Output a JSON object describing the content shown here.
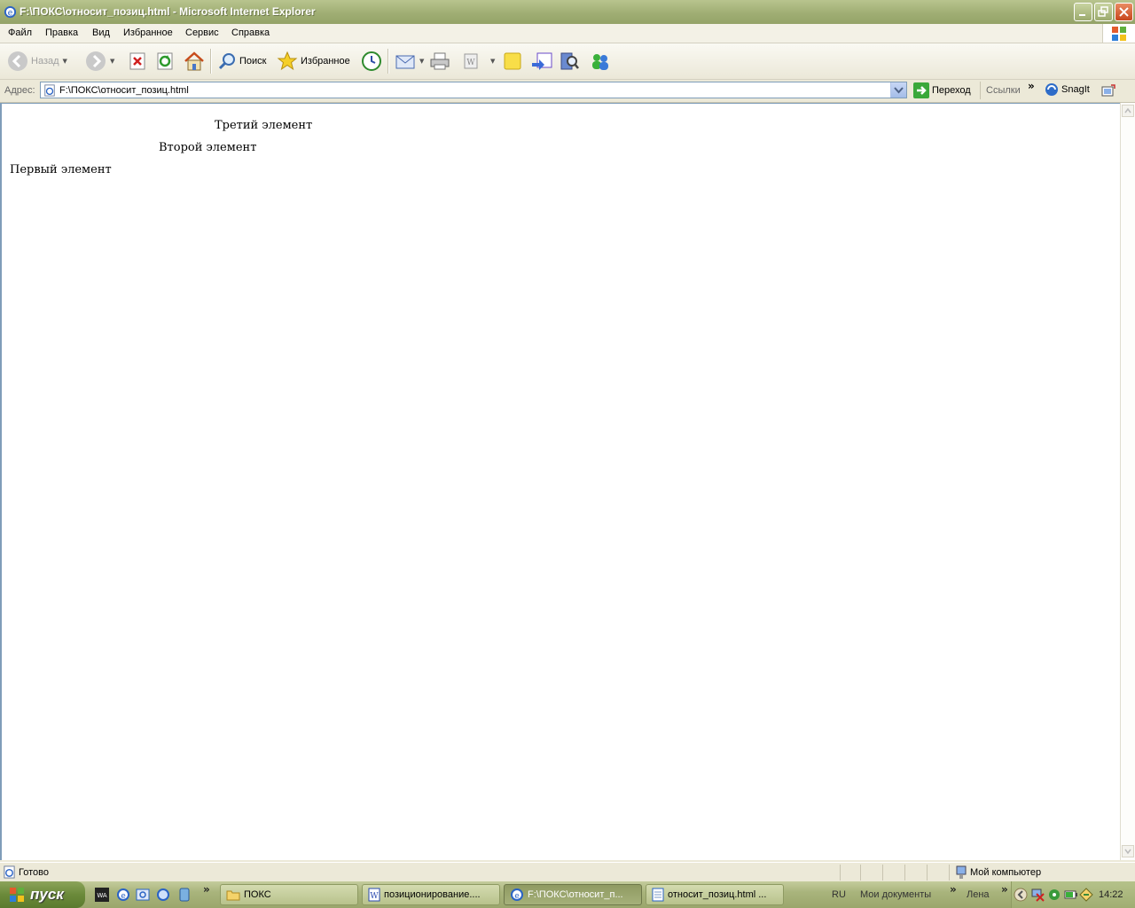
{
  "window": {
    "title": "F:\\ПОКС\\относит_позиц.html - Microsoft Internet Explorer"
  },
  "menu": [
    "Файл",
    "Правка",
    "Вид",
    "Избранное",
    "Сервис",
    "Справка"
  ],
  "toolbar": {
    "back_label": "Назад",
    "search_label": "Поиск",
    "favorites_label": "Избранное"
  },
  "address": {
    "label": "Адрес:",
    "url": "F:\\ПОКС\\относит_позиц.html",
    "go_label": "Переход",
    "links_label": "Ссылки",
    "snagit_label": "SnagIt",
    "chevron": "»"
  },
  "page": {
    "elements": [
      "Третий элемент",
      "Второй элемент",
      "Первый элемент"
    ]
  },
  "status": {
    "text": "Готово",
    "zone": "Мой компьютер"
  },
  "taskbar": {
    "start_label": "пуск",
    "tasks": [
      "ПОКС",
      "позиционирование....",
      "F:\\ПОКС\\относит_п...",
      "относит_позиц.html ..."
    ],
    "lang": "RU",
    "docs_label": "Мои документы",
    "user_label": "Лена",
    "clock": "14:22",
    "chevron": "»"
  }
}
